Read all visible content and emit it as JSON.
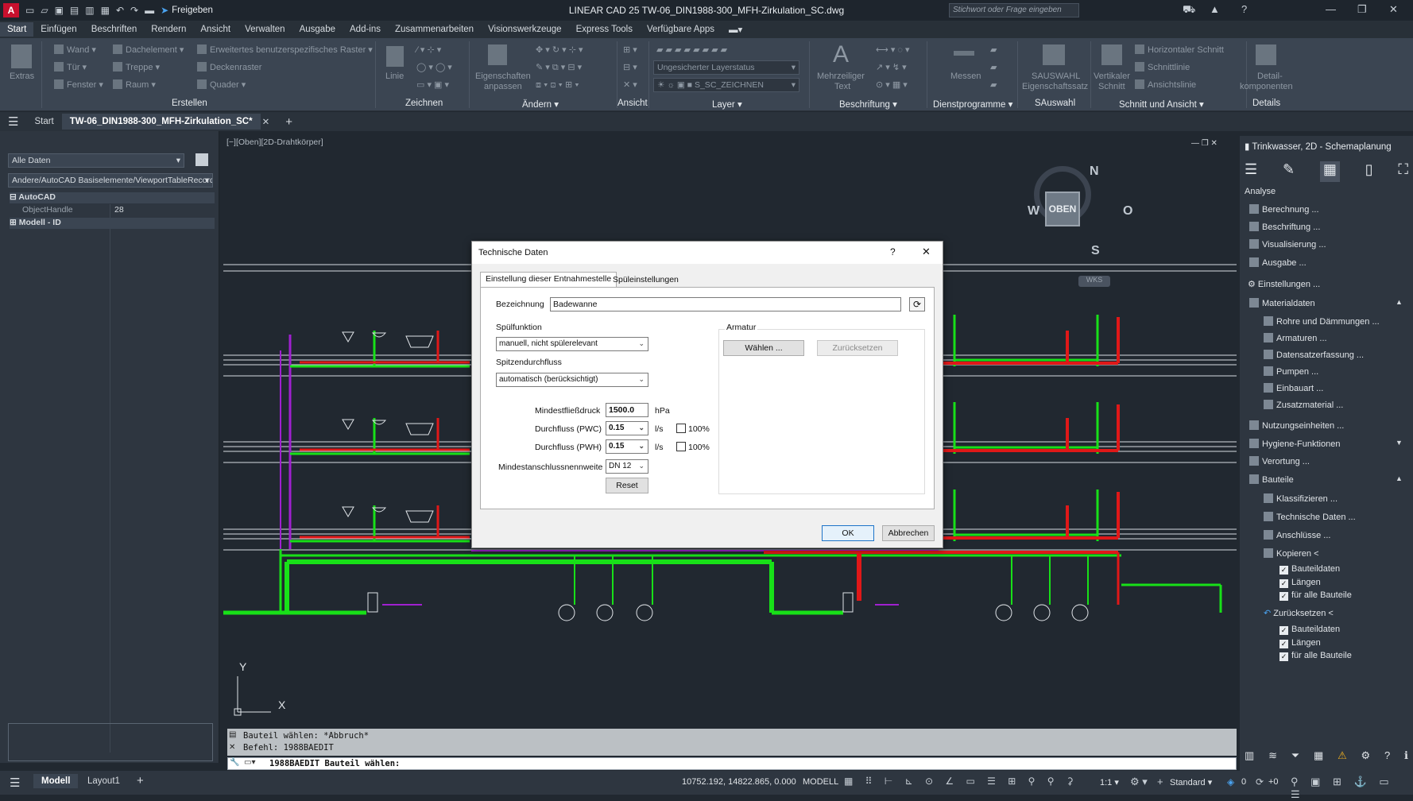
{
  "app": {
    "logo": "A",
    "title": "LINEAR CAD 25    TW-06_DIN1988-300_MFH-Zirkulation_SC.dwg",
    "share_label": "Freigeben",
    "search_placeholder": "Stichwort oder Frage eingeben"
  },
  "ribbon_tabs": [
    "Start",
    "Einfügen",
    "Beschriften",
    "Rendern",
    "Ansicht",
    "Verwalten",
    "Ausgabe",
    "Add-ins",
    "Zusammenarbeiten",
    "Visionswerkzeuge",
    "Express Tools",
    "Verfügbare Apps"
  ],
  "ribbon": {
    "extras": "Extras",
    "wand": "Wand",
    "tuer": "Tür",
    "fenster": "Fenster",
    "dachelement": "Dachelement",
    "treppe": "Treppe",
    "raum": "Raum",
    "raster": "Erweitertes benutzerspezifisches Raster",
    "deckenraster": "Deckenraster",
    "quader": "Quader",
    "linie": "Linie",
    "eigenschaften_1": "Eigenschaften",
    "eigenschaften_2": "anpassen",
    "layerstatus": "Ungesicherter Layerstatus",
    "layer_current": "S_SC_ZEICHNEN",
    "mehrzeiliger_1": "Mehrzeiliger",
    "mehrzeiliger_2": "Text",
    "messen": "Messen",
    "sauswahl_1": "SAUSWAHL",
    "sauswahl_2": "Eigenschaftssatz",
    "vertikaler_1": "Vertikaler",
    "vertikaler_2": "Schnitt",
    "horizontaler": "Horizontaler Schnitt",
    "schnittlinie": "Schnittlinie",
    "ansichtslinie": "Ansichtslinie",
    "detail_1": "Detail-",
    "detail_2": "komponenten",
    "groups": [
      "Erstellen",
      "Zeichnen",
      "Ändern",
      "Ansicht",
      "Layer",
      "Beschriftung",
      "Dienstprogramme",
      "SAuswahl",
      "Schnitt und Ansicht",
      "Details"
    ]
  },
  "doc_tabs": {
    "start": "Start",
    "active": "TW-06_DIN1988-300_MFH-Zirkulation_SC*"
  },
  "left_panel": {
    "filter": "Alle Daten",
    "path": "Andere/AutoCAD Basiselemente/ViewportTableRecord",
    "group_autocad": "AutoCAD",
    "prop_name": "ObjectHandle",
    "prop_value": "28",
    "group_modell": "Modell - ID"
  },
  "viewport_label": "[−][Oben][2D-Drahtkörper]",
  "viewcube": {
    "n": "N",
    "s": "S",
    "w": "W",
    "o": "O",
    "center": "OBEN",
    "wks": "WKS"
  },
  "axes": {
    "x": "X",
    "y": "Y"
  },
  "command_line": {
    "line1": "Bauteil wählen: *Abbruch*",
    "line2": "Befehl: 1988BAEDIT",
    "input": "1988BAEDIT Bauteil wählen:"
  },
  "status": {
    "modell": "Modell",
    "layout": "Layout1",
    "coords": "10752.192, 14822.865, 0.000",
    "mode": "MODELL",
    "scale": "1:1",
    "style": "Standard",
    "zero": "0",
    "plus0": "+0"
  },
  "right_panel": {
    "title": "Trinkwasser, 2D - Schemaplanung",
    "section": "Analyse",
    "items": [
      "Berechnung ...",
      "Beschriftung ...",
      "Visualisierung ...",
      "Ausgabe ..."
    ],
    "einstellungen": "Einstellungen ...",
    "materialdaten": "Materialdaten",
    "mat_items": [
      "Rohre und Dämmungen ...",
      "Armaturen ...",
      "Datensatzerfassung ...",
      "Pumpen ...",
      "Einbauart ...",
      "Zusatzmaterial ..."
    ],
    "nutzung": "Nutzungseinheiten ...",
    "hygiene": "Hygiene-Funktionen",
    "verortung": "Verortung ...",
    "bauteile": "Bauteile",
    "bt_items": [
      "Klassifizieren ...",
      "Technische Daten ...",
      "Anschlüsse ..."
    ],
    "kopieren": "Kopieren <",
    "kopieren_opts": [
      "Bauteildaten",
      "Längen",
      "für alle Bauteile"
    ],
    "zuruecksetzen": "Zurücksetzen <",
    "zurueck_opts": [
      "Bauteildaten",
      "Längen",
      "für alle Bauteile"
    ]
  },
  "dialog": {
    "title": "Technische Daten",
    "help": "?",
    "tab1": "Einstellung dieser Entnahmestelle",
    "tab2": "Spüleinstellungen",
    "bezeichnung_label": "Bezeichnung",
    "bezeichnung_value": "Badewanne",
    "spuelfunktion_label": "Spülfunktion",
    "spuelfunktion_value": "manuell, nicht spülerelevant",
    "spitzen_label": "Spitzendurchfluss",
    "spitzen_value": "automatisch (berücksichtigt)",
    "mindestdruck_label": "Mindestfließdruck",
    "mindestdruck_value": "1500.0",
    "mindestdruck_unit": "hPa",
    "pwc_label": "Durchfluss (PWC)",
    "pwc_value": "0.15",
    "pwc_unit": "l/s",
    "pwh_label": "Durchfluss (PWH)",
    "pwh_value": "0.15",
    "pwh_unit": "l/s",
    "pct_label": "100%",
    "dn_label": "Mindestanschlussnennweite",
    "dn_value": "DN 12",
    "reset": "Reset",
    "armatur_label": "Armatur",
    "waehlen": "Wählen ...",
    "zuruecksetzen": "Zurücksetzen",
    "ok": "OK",
    "abbrechen": "Abbrechen"
  },
  "colors": {
    "pwc": "#18e018",
    "pwh": "#e01818",
    "circ": "#a020d0",
    "accent": "#1e74c8"
  }
}
